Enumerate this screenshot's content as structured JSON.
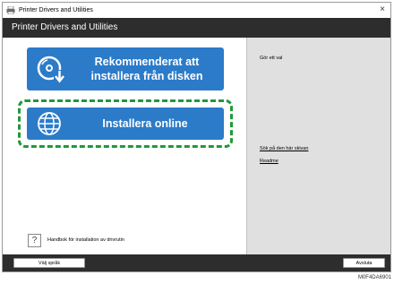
{
  "window": {
    "title": "Printer Drivers and Utilities",
    "close_glyph": "×"
  },
  "header": {
    "title": "Printer Drivers and Utilities"
  },
  "main": {
    "install_from_disk": "Rekommenderat att installera från disken",
    "install_online": "Installera online"
  },
  "sidebar": {
    "hint": "Gör ett val",
    "links": [
      "Sök på den här skivan",
      "Readme"
    ]
  },
  "help": {
    "glyph": "?",
    "label": "Handbok för installation av drivrutin"
  },
  "footer": {
    "language_button": "Välj språk",
    "exit_button": "Avsluta"
  },
  "figure_code": "M0F4DA6901",
  "colors": {
    "accent": "#2b7bc9",
    "highlight": "#1f9a3a",
    "bar": "#2d2d2d",
    "panel": "#e0e0e0"
  },
  "icons": [
    "printer-icon",
    "disc-download-icon",
    "globe-icon",
    "question-icon",
    "close-icon"
  ]
}
